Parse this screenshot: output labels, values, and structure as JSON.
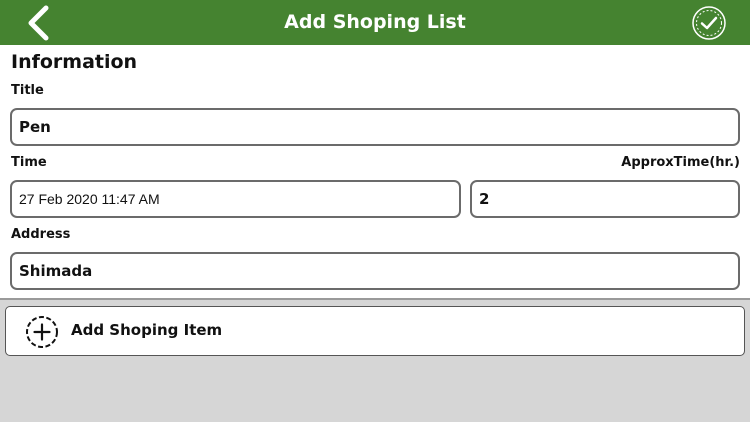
{
  "header": {
    "title": "Add Shoping List",
    "back_icon": "chevron-left-icon",
    "done_icon": "check-circle-icon"
  },
  "colors": {
    "header_bg": "#458330",
    "background": "#d6d6d6"
  },
  "form": {
    "section_title": "Information",
    "title_label": "Title",
    "title_value": "Pen",
    "time_label": "Time",
    "time_value": "27 Feb 2020 11:47 AM",
    "approx_label": "ApproxTime(hr.)",
    "approx_value": "2",
    "address_label": "Address",
    "address_value": "Shimada"
  },
  "add_item": {
    "label": "Add Shoping Item",
    "icon": "plus-circle-icon"
  }
}
